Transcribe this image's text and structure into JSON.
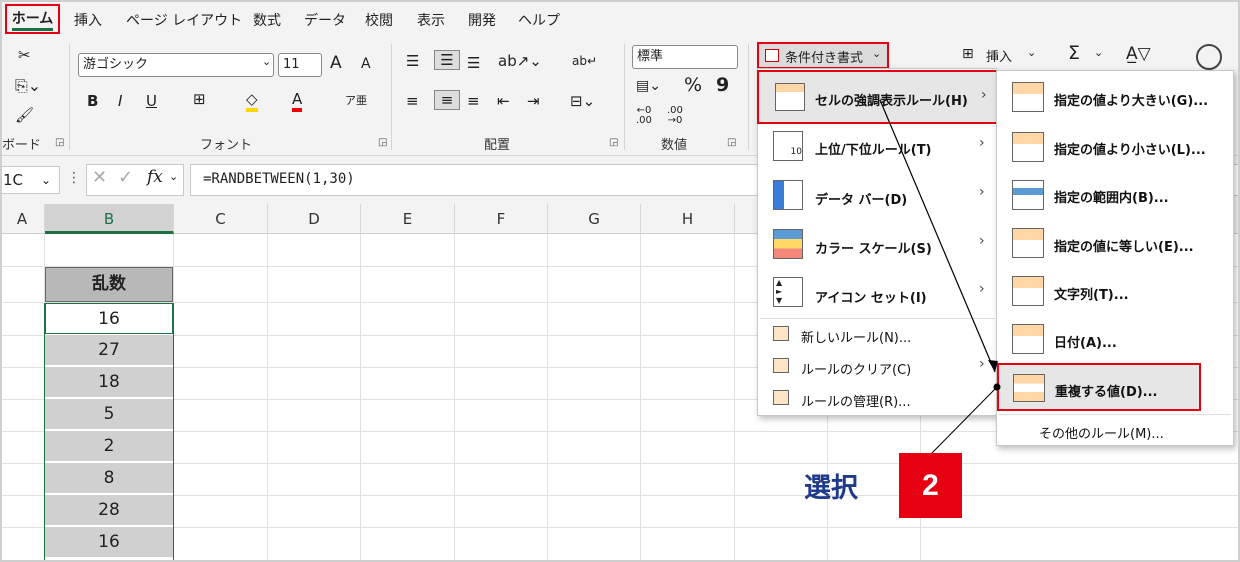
{
  "tabs": [
    "ホーム",
    "挿入",
    "ページ レイアウト",
    "数式",
    "データ",
    "校閲",
    "表示",
    "開発",
    "ヘルプ"
  ],
  "ribbon": {
    "font_name": "游ゴシック",
    "font_size": "11",
    "font_group": "フォント",
    "clipboard_group": "ボード",
    "align_group": "配置",
    "number_group": "数値",
    "number_format": "標準",
    "cond_format": "条件付き書式",
    "insert": "挿入",
    "sum": "Σ",
    "grow": "A",
    "shrink": "A",
    "bold": "B",
    "italic": "I",
    "underline": "U",
    "fontcolor": "A",
    "percent": "%",
    "comma": "9"
  },
  "formula_bar": {
    "name_box": "1C",
    "fx": "fx",
    "formula": "=RANDBETWEEN(1,30)"
  },
  "columns": [
    "A",
    "B",
    "C",
    "D",
    "E",
    "F",
    "G",
    "H"
  ],
  "table": {
    "header": "乱数",
    "values": [
      "16",
      "27",
      "18",
      "5",
      "2",
      "8",
      "28",
      "16"
    ]
  },
  "menu": {
    "items": [
      "セルの強調表示ルール(H)",
      "上位/下位ルール(T)",
      "データ バー(D)",
      "カラー スケール(S)",
      "アイコン セット(I)"
    ],
    "simple_items": [
      "新しいルール(N)...",
      "ルールのクリア(C)",
      "ルールの管理(R)..."
    ]
  },
  "submenu": {
    "items": [
      "指定の値より大きい(G)...",
      "指定の値より小さい(L)...",
      "指定の範囲内(B)...",
      "指定の値に等しい(E)...",
      "文字列(T)...",
      "日付(A)...",
      "重複する値(D)..."
    ],
    "more": "その他のルール(M)..."
  },
  "annotation": {
    "text": "選択",
    "step": "2"
  },
  "colors": {
    "accent": "#1e7145",
    "highlight": "#e60012",
    "annotation": "#1f3a8a"
  }
}
